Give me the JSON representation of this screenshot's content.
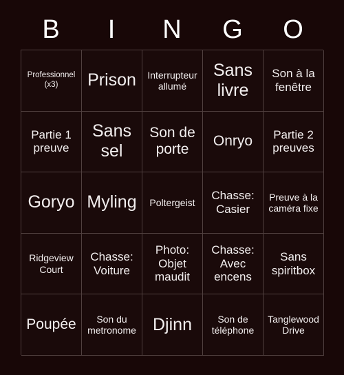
{
  "header": {
    "letters": [
      "B",
      "I",
      "N",
      "G",
      "O"
    ]
  },
  "grid": {
    "rows": 5,
    "columns": 5,
    "cells": [
      {
        "text": "Professionnel (x3)",
        "size": "t-xs"
      },
      {
        "text": "Prison",
        "size": "t-xl"
      },
      {
        "text": "Interrupteur allumé",
        "size": "t-sm"
      },
      {
        "text": "Sans livre",
        "size": "t-xl"
      },
      {
        "text": "Son à la fenêtre",
        "size": "t-md"
      },
      {
        "text": "Partie 1 preuve",
        "size": "t-md"
      },
      {
        "text": "Sans sel",
        "size": "t-xl"
      },
      {
        "text": "Son de porte",
        "size": "t-lg"
      },
      {
        "text": "Onryo",
        "size": "t-lg"
      },
      {
        "text": "Partie 2 preuves",
        "size": "t-md"
      },
      {
        "text": "Goryo",
        "size": "t-xl"
      },
      {
        "text": "Myling",
        "size": "t-xl"
      },
      {
        "text": "Poltergeist",
        "size": "t-sm"
      },
      {
        "text": "Chasse: Casier",
        "size": "t-md"
      },
      {
        "text": "Preuve à la caméra fixe",
        "size": "t-sm"
      },
      {
        "text": "Ridgeview Court",
        "size": "t-sm"
      },
      {
        "text": "Chasse: Voiture",
        "size": "t-md"
      },
      {
        "text": "Photo: Objet maudit",
        "size": "t-md"
      },
      {
        "text": "Chasse: Avec encens",
        "size": "t-md"
      },
      {
        "text": "Sans spiritbox",
        "size": "t-md"
      },
      {
        "text": "Poupée",
        "size": "t-lg"
      },
      {
        "text": "Son du metronome",
        "size": "t-sm"
      },
      {
        "text": "Djinn",
        "size": "t-xl"
      },
      {
        "text": "Son de téléphone",
        "size": "t-sm"
      },
      {
        "text": "Tanglewood Drive",
        "size": "t-sm"
      }
    ]
  },
  "colors": {
    "background": "#180707",
    "cell_background": "#1a0a0a",
    "grid_line": "#50403f",
    "text": "#f2eeee",
    "header_text": "#ffffff"
  }
}
